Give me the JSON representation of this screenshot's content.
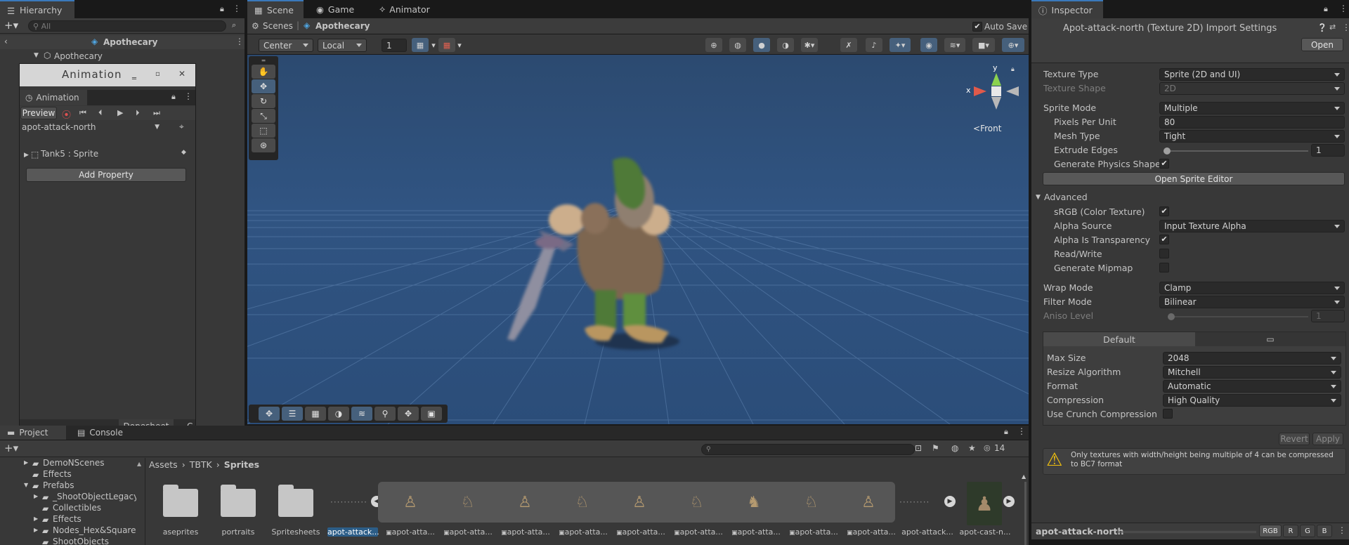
{
  "hierarchy": {
    "tab": "Hierarchy",
    "search_placeholder": "All",
    "scene": "Apothecary",
    "root_item": "Apothecary"
  },
  "animation": {
    "window_title": "Animation",
    "tab": "Animation",
    "preview": "Preview",
    "clip": "apot-attack-north",
    "property": "Tank5 : Sprite",
    "add_property": "Add Property",
    "dopesheet": "Dopesheet",
    "curves_short": "C"
  },
  "scene_tabs": {
    "scene": "Scene",
    "game": "Game",
    "animator": "Animator",
    "auto_save": "Auto Save"
  },
  "scene_bar": {
    "scenes": "Scenes",
    "current": "Apothecary",
    "pivot": "Center",
    "space": "Local",
    "grid_value": "1"
  },
  "gizmo": {
    "x": "x",
    "y": "y",
    "view": "Front"
  },
  "inspector": {
    "tab": "Inspector",
    "title": "Apot-attack-north (Texture 2D) Import Settings",
    "open": "Open",
    "rows": [
      {
        "label": "Texture Type",
        "value": "Sprite (2D and UI)"
      },
      {
        "label": "Texture Shape",
        "value": "2D"
      },
      {
        "label": "Sprite Mode",
        "value": "Multiple"
      },
      {
        "label": "Pixels Per Unit",
        "value": "80"
      },
      {
        "label": "Mesh Type",
        "value": "Tight"
      },
      {
        "label": "Extrude Edges",
        "value": "1"
      },
      {
        "label": "Generate Physics Shape",
        "value": "✔"
      }
    ],
    "open_sprite_editor": "Open Sprite Editor",
    "advanced": "Advanced",
    "adv_rows": [
      {
        "label": "sRGB (Color Texture)",
        "value": "✔"
      },
      {
        "label": "Alpha Source",
        "value": "Input Texture Alpha"
      },
      {
        "label": "Alpha Is Transparency",
        "value": "✔"
      },
      {
        "label": "Read/Write",
        "value": ""
      },
      {
        "label": "Generate Mipmap",
        "value": ""
      }
    ],
    "wrap": {
      "label": "Wrap Mode",
      "value": "Clamp"
    },
    "filter": {
      "label": "Filter Mode",
      "value": "Bilinear"
    },
    "aniso": {
      "label": "Aniso Level",
      "value": "1"
    },
    "platform_tab": "Default",
    "plat_rows": [
      {
        "label": "Max Size",
        "value": "2048"
      },
      {
        "label": "Resize Algorithm",
        "value": "Mitchell"
      },
      {
        "label": "Format",
        "value": "Automatic"
      },
      {
        "label": "Compression",
        "value": "High Quality"
      },
      {
        "label": "Use Crunch Compression",
        "value": ""
      }
    ],
    "revert": "Revert",
    "apply": "Apply",
    "warning": "Only textures with width/height being multiple of 4 can be compressed to BC7 format",
    "preview_name": "apot-attack-north",
    "channels": [
      "RGB",
      "R",
      "G",
      "B"
    ]
  },
  "project": {
    "tab": "Project",
    "console": "Console",
    "count": "14",
    "tree": [
      "DemoNScenes",
      "Effects",
      "Prefabs",
      "_ShootObjectLegacy",
      "Collectibles",
      "Effects",
      "Nodes_Hex&Square",
      "ShootObjects"
    ],
    "breadcrumb": [
      "Assets",
      "TBTK",
      "Sprites"
    ],
    "folders": [
      "aseprites",
      "portraits",
      "Spritesheets"
    ],
    "selected": "apot-attack...",
    "assets": [
      "apot-atta...",
      "apot-atta...",
      "apot-atta...",
      "apot-atta...",
      "apot-atta...",
      "apot-atta...",
      "apot-atta...",
      "apot-atta...",
      "apot-atta..."
    ],
    "after": [
      "apot-attack...",
      "apot-cast-n..."
    ]
  }
}
